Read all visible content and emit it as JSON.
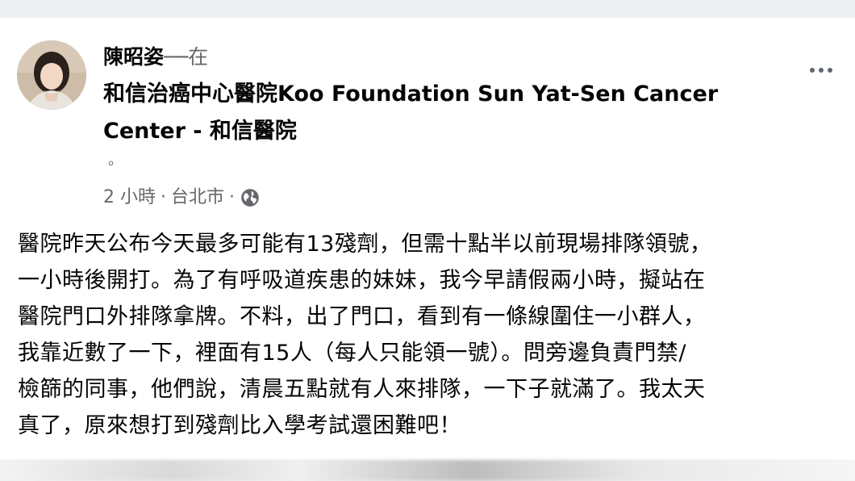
{
  "post": {
    "author": "陳昭姿",
    "at_text": "──在",
    "place": "和信治癌中心醫院Koo Foundation Sun Yat-Sen Cancer Center - 和信醫院",
    "trailing_dot": "。",
    "time": "2 小時",
    "location": "台北市",
    "separator": "·",
    "privacy_icon": "globe-icon",
    "more_icon": "more-options-icon",
    "body_lines": [
      "醫院昨天公布今天最多可能有13殘劑，但需十點半以前現場排隊領號，",
      "一小時後開打。為了有呼吸道疾患的妹妹，我今早請假兩小時，擬站在",
      "醫院門口外排隊拿牌。不料，出了門口，看到有一條線圍住一小群人，",
      "我靠近數了一下，裡面有15人（每人只能領一號）。問旁邊負責門禁/",
      "檢篩的同事，他們說，清晨五點就有人來排隊，一下子就滿了。我太天",
      "真了，原來想打到殘劑比入學考試還困難吧！"
    ]
  },
  "colors": {
    "text": "#050505",
    "secondary": "#65676b",
    "card": "#ffffff",
    "background": "#f0f2f5"
  }
}
